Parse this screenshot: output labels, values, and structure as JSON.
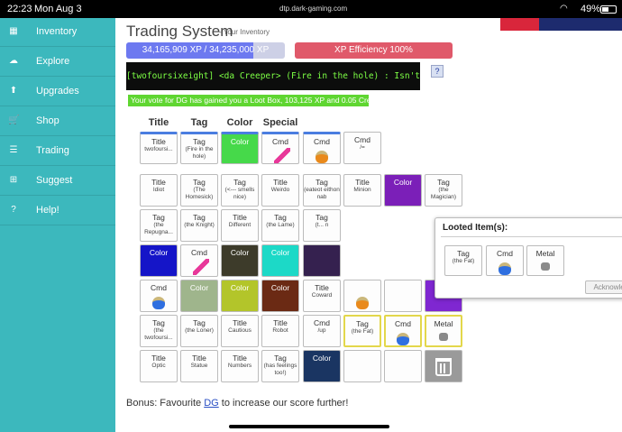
{
  "status_bar": {
    "time": "22:23",
    "date": "Mon Aug 3",
    "url": "dtp.dark-gaming.com",
    "battery": "49%"
  },
  "sidebar": {
    "items": [
      {
        "label": "Inventory",
        "icon": "grid-icon"
      },
      {
        "label": "Explore",
        "icon": "cloud-icon"
      },
      {
        "label": "Upgrades",
        "icon": "arrow-up-icon"
      },
      {
        "label": "Shop",
        "icon": "cart-icon"
      },
      {
        "label": "Trading",
        "icon": "list-icon"
      },
      {
        "label": "Suggest",
        "icon": "plus-box-icon"
      },
      {
        "label": "Help!",
        "icon": "question-icon"
      }
    ]
  },
  "header": {
    "title": "Trading System",
    "subtitle": "- Your Inventory"
  },
  "xp": {
    "text": "34,165,909 XP / 34,235,000 XP",
    "fraction": 0.998,
    "efficiency": "XP Efficiency 100%"
  },
  "banner": {
    "text": "[twofoursixeight] <da Creeper> (Fire in the hole) : Isn't this just the best?",
    "help": "?"
  },
  "vote_message": "Your vote for DG has gained you a Loot Box, 103,125 XP and 0.05 Credits!",
  "equipped": {
    "headers": [
      "Title",
      "Tag",
      "Color",
      "Special"
    ],
    "slots": [
      {
        "t1": "Title",
        "t2": "twofoursi..."
      },
      {
        "t1": "Tag",
        "t2": "(Fire in the hole)"
      },
      {
        "t1": "Color",
        "t2": "",
        "color": "#46d94a"
      },
      {
        "t1": "Cmd",
        "t2": "",
        "glyph": "sword"
      },
      {
        "t1": "Cmd",
        "t2": "",
        "glyph": "potion-orange"
      },
      {
        "t1": "Cmd",
        "t2": "/="
      }
    ]
  },
  "inventory": [
    [
      {
        "t1": "Title",
        "t2": "Idiot"
      },
      {
        "t1": "Tag",
        "t2": "(The Homesick)"
      },
      {
        "t1": "Tag",
        "t2": "(<--- smells nice)"
      },
      {
        "t1": "Title",
        "t2": "Weirdo"
      },
      {
        "t1": "Tag",
        "t2": "(eateot eithon nab"
      },
      {
        "t1": "Title",
        "t2": "Minion"
      },
      {
        "t1": "Color",
        "t2": "",
        "color": "#7b1fb8"
      },
      {
        "t1": "Tag",
        "t2": "(the Magician)"
      }
    ],
    [
      {
        "t1": "Tag",
        "t2": "(the Repugna..."
      },
      {
        "t1": "Tag",
        "t2": "(the Knight)"
      },
      {
        "t1": "Title",
        "t2": "Different"
      },
      {
        "t1": "Tag",
        "t2": "(the Lame)"
      },
      {
        "t1": "Tag",
        "t2": "(t... n"
      }
    ],
    [
      {
        "t1": "Color",
        "t2": "",
        "color": "#1515c8"
      },
      {
        "t1": "Cmd",
        "t2": "",
        "glyph": "sword"
      },
      {
        "t1": "Color",
        "t2": "",
        "color": "#3d3b2a"
      },
      {
        "t1": "Color",
        "t2": "",
        "color": "#1cd9c7"
      },
      {
        "t1": "",
        "t2": "",
        "color": "#35214f"
      }
    ],
    [
      {
        "t1": "Cmd",
        "t2": "",
        "glyph": "potion-blue"
      },
      {
        "t1": "Color",
        "t2": "",
        "color": "#9fb58c"
      },
      {
        "t1": "Color",
        "t2": "",
        "color": "#b3c52a"
      },
      {
        "t1": "Color",
        "t2": "",
        "color": "#6b2a14"
      },
      {
        "t1": "Title",
        "t2": "Coward"
      },
      {
        "t1": "",
        "t2": "",
        "glyph": "potion-orange"
      },
      {
        "t1": "",
        "t2": ""
      },
      {
        "t1": "Color",
        "t2": "",
        "color": "#7f27d1"
      }
    ],
    [
      {
        "t1": "Tag",
        "t2": "(the twofoursi..."
      },
      {
        "t1": "Tag",
        "t2": "(the Loner)"
      },
      {
        "t1": "Title",
        "t2": "Cautious"
      },
      {
        "t1": "Title",
        "t2": "Robot"
      },
      {
        "t1": "Cmd",
        "t2": "/up"
      },
      {
        "t1": "Tag",
        "t2": "(the Fat)",
        "sel": true
      },
      {
        "t1": "Cmd",
        "t2": "",
        "glyph": "potion-blue",
        "sel": true
      },
      {
        "t1": "Metal",
        "t2": "",
        "glyph": "metal",
        "sel": true
      }
    ],
    [
      {
        "t1": "Title",
        "t2": "Optic"
      },
      {
        "t1": "Title",
        "t2": "Statue"
      },
      {
        "t1": "Title",
        "t2": "Numbers"
      },
      {
        "t1": "Tag",
        "t2": "(has feelings too!)"
      },
      {
        "t1": "Color",
        "t2": "",
        "color": "#1a3562"
      },
      {
        "t1": "",
        "t2": ""
      },
      {
        "t1": "",
        "t2": ""
      },
      {
        "t1": "",
        "t2": "",
        "trash": true
      }
    ]
  ],
  "popup": {
    "title": "Looted Item(s):",
    "items": [
      {
        "t1": "Tag",
        "t2": "(the Fat)"
      },
      {
        "t1": "Cmd",
        "t2": "",
        "glyph": "potion-blue"
      },
      {
        "t1": "Metal",
        "t2": "",
        "glyph": "metal"
      }
    ],
    "button": "Acknowledged"
  },
  "bonus": {
    "before": "Bonus: Favourite ",
    "link": "DG",
    "after": " to increase our score further!"
  }
}
